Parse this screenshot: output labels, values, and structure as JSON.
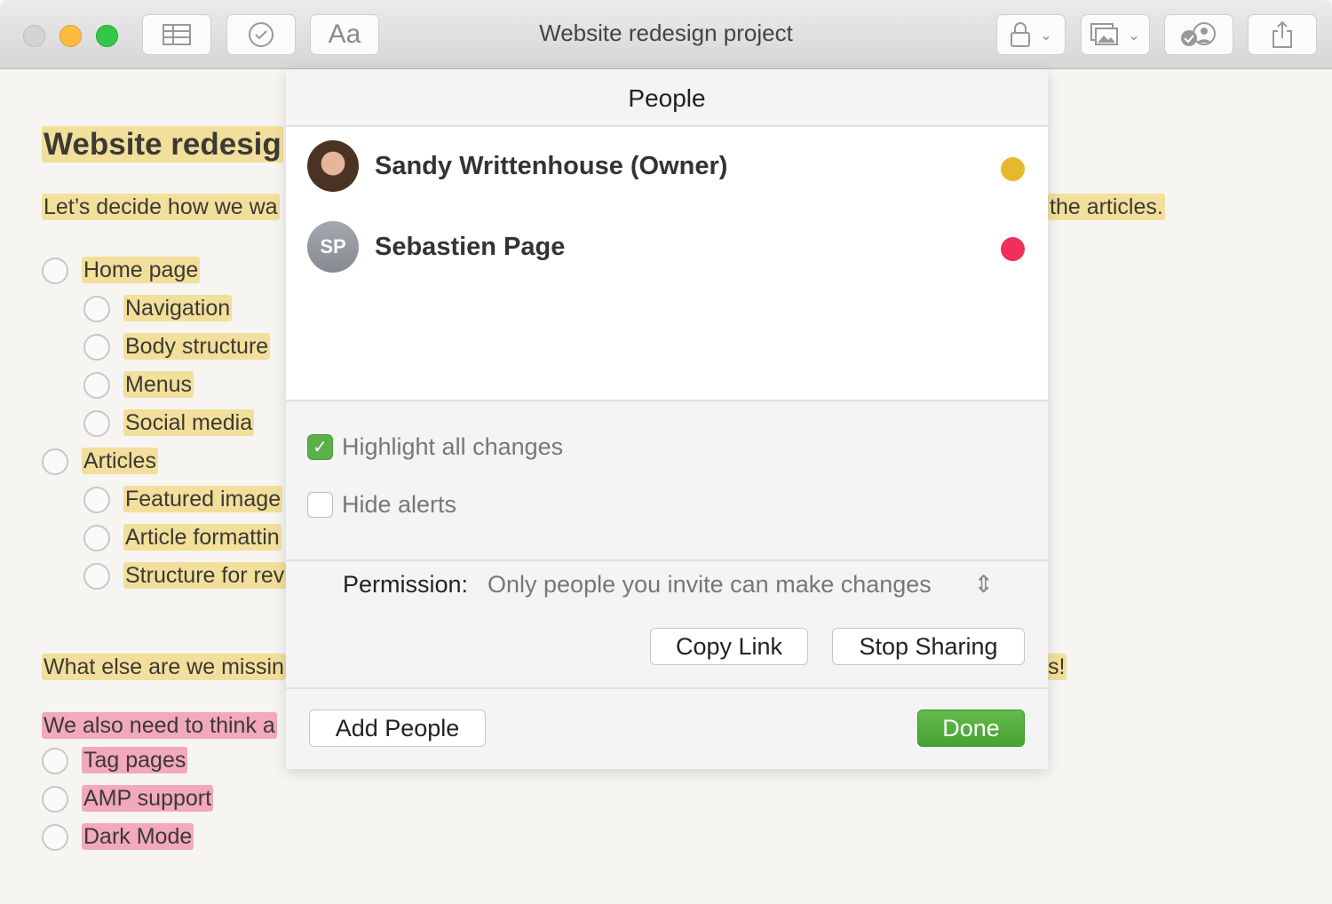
{
  "window": {
    "title": "Website redesign project",
    "toolbar": {
      "text_format_label": "Aa"
    }
  },
  "note": {
    "title": "Website redesig",
    "intro_left": "Let’s decide how we wa",
    "intro_right": "the articles.",
    "items": [
      {
        "label": "Home page",
        "indent": 0
      },
      {
        "label": "Navigation",
        "indent": 1
      },
      {
        "label": "Body structure",
        "indent": 1
      },
      {
        "label": "Menus",
        "indent": 1
      },
      {
        "label": "Social media",
        "indent": 1
      },
      {
        "label": "Articles",
        "indent": 0
      },
      {
        "label": "Featured image",
        "indent": 1
      },
      {
        "label": "Article formattin",
        "indent": 1
      },
      {
        "label": "Structure for rev",
        "indent": 1
      }
    ],
    "question_left": "What else are we missin",
    "question_right": "s!",
    "also": "We also need to think a",
    "pink_items": [
      "Tag pages",
      "AMP support",
      "Dark Mode"
    ]
  },
  "people_sheet": {
    "title": "People",
    "people": [
      {
        "name": "Sandy Writtenhouse (Owner)",
        "initials": "",
        "color": "#e8b82c"
      },
      {
        "name": "Sebastien Page",
        "initials": "SP",
        "color": "#f0305a"
      }
    ],
    "highlight_all_changes": {
      "label": "Highlight all changes",
      "checked": true
    },
    "hide_alerts": {
      "label": "Hide alerts",
      "checked": false
    },
    "permission_label": "Permission:",
    "permission_value": "Only people you invite can make changes",
    "copy_link": "Copy Link",
    "stop_sharing": "Stop Sharing",
    "add_people": "Add People",
    "done": "Done"
  }
}
